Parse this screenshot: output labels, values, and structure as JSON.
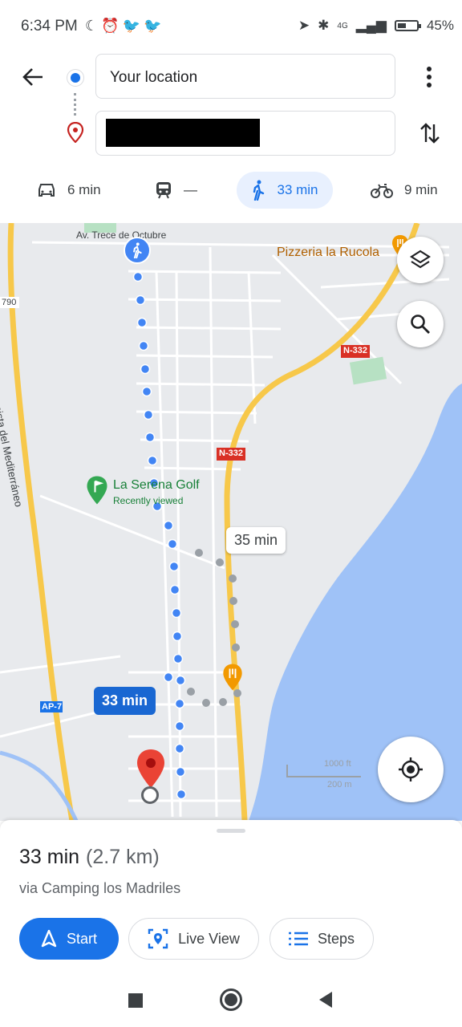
{
  "status_bar": {
    "time": "6:34 PM",
    "left_icons": [
      "moon-icon",
      "alarm-icon",
      "twitter-icon",
      "twitter-icon"
    ],
    "network": "4G",
    "battery": "45%"
  },
  "route": {
    "from_text": "Your location",
    "to_text": ""
  },
  "modes": [
    {
      "name": "drive",
      "label": "6 min"
    },
    {
      "name": "transit",
      "label": "—"
    },
    {
      "name": "walk",
      "label": "33 min",
      "selected": true
    },
    {
      "name": "bike",
      "label": "9 min"
    }
  ],
  "map": {
    "labels": {
      "street_top": "Av. Trece de Octubre",
      "pizzeria": "Pizzeria la Rucola",
      "golf_name": "La Serena Golf",
      "golf_sub": "Recently viewed",
      "highway": "Autopista del Mediterráneo",
      "road_790": "790",
      "n332_a": "N-332",
      "n332_b": "N-332",
      "ap7": "AP-7",
      "scale_ft": "1000 ft",
      "scale_m": "200 m"
    },
    "alt_route_time": "35 min",
    "main_route_time": "33 min"
  },
  "sheet": {
    "duration": "33 min",
    "distance": "(2.7 km)",
    "via": "via Camping los Madriles",
    "start_label": "Start",
    "live_view_label": "Live View",
    "steps_label": "Steps"
  },
  "colors": {
    "accent": "#1a73e8",
    "water": "#9fc2f7",
    "road_major": "#f7c84a",
    "route_dots": "#4285f4"
  }
}
